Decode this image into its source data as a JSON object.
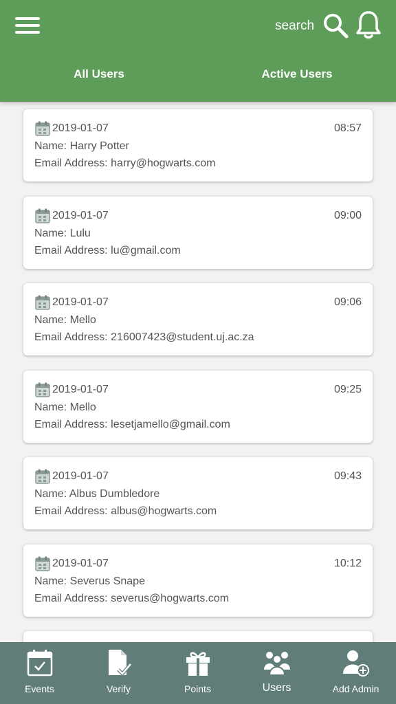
{
  "header": {
    "search_label": "search",
    "tabs": [
      {
        "label": "All Users"
      },
      {
        "label": "Active Users"
      }
    ],
    "color": "#5e9c59"
  },
  "users": [
    {
      "date": "2019-01-07",
      "time": "08:57",
      "name": "Name: Harry Potter",
      "email": "Email Address: harry@hogwarts.com"
    },
    {
      "date": "2019-01-07",
      "time": "09:00",
      "name": "Name: Lulu",
      "email": "Email Address: lu@gmail.com"
    },
    {
      "date": "2019-01-07",
      "time": "09:06",
      "name": "Name: Mello",
      "email": "Email Address: 216007423@student.uj.ac.za"
    },
    {
      "date": "2019-01-07",
      "time": "09:25",
      "name": "Name: Mello",
      "email": "Email Address: lesetjamello@gmail.com"
    },
    {
      "date": "2019-01-07",
      "time": "09:43",
      "name": "Name: Albus Dumbledore",
      "email": "Email Address: albus@hogwarts.com"
    },
    {
      "date": "2019-01-07",
      "time": "10:12",
      "name": "Name: Severus Snape",
      "email": "Email Address: severus@hogwarts.com"
    }
  ],
  "bottom_nav": {
    "items": [
      {
        "label": "Events",
        "icon": "calendar-check-icon"
      },
      {
        "label": "Verify",
        "icon": "document-check-icon"
      },
      {
        "label": "Points",
        "icon": "gift-icon"
      },
      {
        "label": "Users",
        "icon": "users-group-icon",
        "active": true
      },
      {
        "label": "Add Admin",
        "icon": "add-user-icon"
      }
    ],
    "color": "#607d79"
  }
}
